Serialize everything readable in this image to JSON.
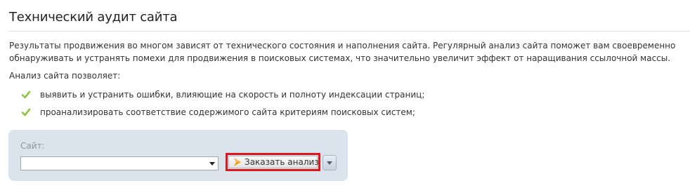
{
  "page": {
    "title": "Технический аудит сайта",
    "intro": "Результаты продвижения во многом зависят от технического состояния и наполнения сайта. Регулярный анализ сайта поможет вам своевременно обнаруживать и устранять помехи для продвижения в поисковых системах, что значительно увеличит эффект от наращивания ссылочной массы.",
    "allows_label": "Анализ сайта позволяет:",
    "benefits": [
      "выявить и устранить ошибки, влияющие на скорость и полноту индексации страниц;",
      "проанализировать соответствие содержимого сайта критериям поисковых систем;"
    ]
  },
  "form": {
    "site_label": "Сайт:",
    "site_value": "",
    "order_button_label": "Заказать анализ",
    "order_icon": "orange-arrow-icon",
    "dropdown_icon": "chevron-down-icon"
  },
  "colors": {
    "check": "#8cc63f",
    "panel": "#dbe4ec",
    "highlight": "#e0161b",
    "order_icon": "#f39c12"
  }
}
